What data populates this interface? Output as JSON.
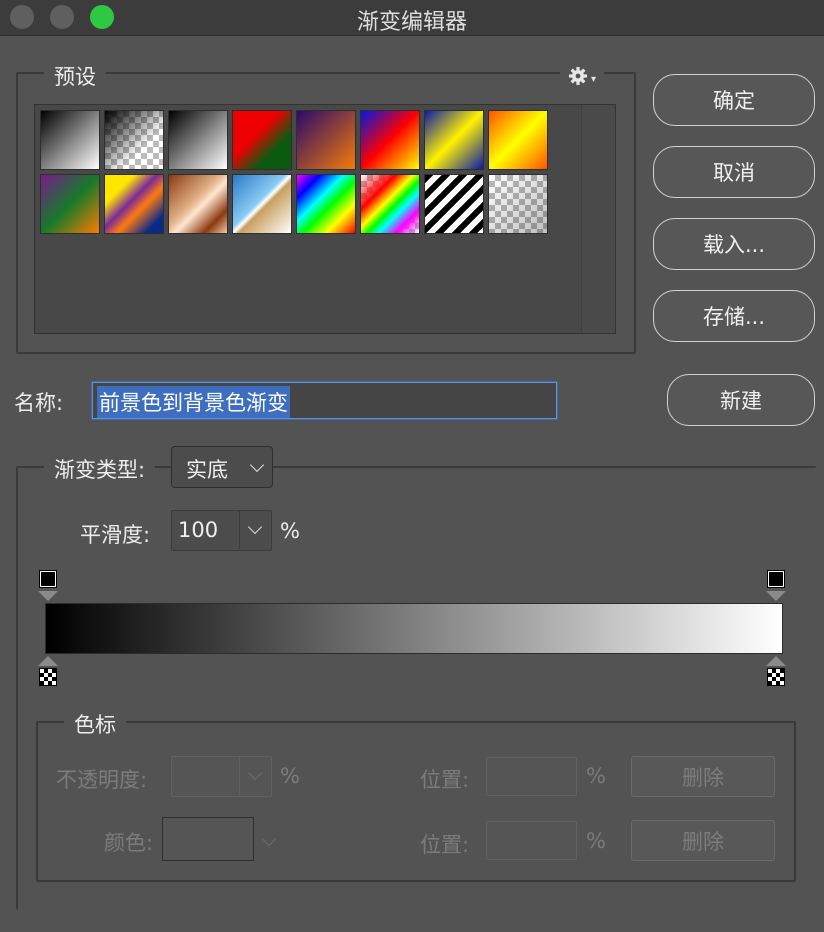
{
  "window": {
    "title": "渐变编辑器"
  },
  "presets": {
    "legend": "预设",
    "menu_icon": "gear-icon",
    "swatches": [
      {
        "name": "foreground-to-background",
        "css": "linear-gradient(135deg,#000 0%,#fff 100%)"
      },
      {
        "name": "foreground-to-transparent",
        "css": "linear-gradient(135deg,#000 0%,rgba(0,0,0,0) 65%)",
        "checker": true
      },
      {
        "name": "black-white",
        "css": "linear-gradient(135deg,#000 0%,#fff 100%)"
      },
      {
        "name": "red-green",
        "css": "linear-gradient(135deg,#e00 0%,#e00 40%,#0a5a10 70%,#0a5a10 100%)"
      },
      {
        "name": "violet-orange",
        "css": "linear-gradient(135deg,#2a0a6a 0%,#f47a08 100%)"
      },
      {
        "name": "blue-red-yellow",
        "css": "linear-gradient(135deg,#0018e0 0%,#ff0000 50%,#ffff00 100%)"
      },
      {
        "name": "blue-yellow-blue",
        "css": "linear-gradient(135deg,#0a1aa8 0%,#fff200 50%,#0a1aa8 100%)"
      },
      {
        "name": "orange-yellow-orange",
        "css": "linear-gradient(135deg,#ff5500 0%,#ffff00 50%,#ff5500 100%)"
      },
      {
        "name": "violet-green-orange",
        "css": "linear-gradient(135deg,#7a1a8c 0%,#167a2a 50%,#ff7a00 100%)"
      },
      {
        "name": "yellow-violet-orange-blue",
        "css": "linear-gradient(135deg,#ffe600 0%,#ffe600 25%,#7a2a9a 45%,#ff7a10 60%,#0a2a8a 85%)"
      },
      {
        "name": "copper",
        "css": "linear-gradient(135deg,#8a3a10 0%,#e4b48a 45%,#ffe6d0 55%,#8a3a10 80%,#f2c8a8 100%)"
      },
      {
        "name": "chrome",
        "css": "linear-gradient(135deg,#2a7ac8 0%,#8acbf4 45%,#ffffff 50%,#c8a060 55%,#fff 100%)"
      },
      {
        "name": "spectrum",
        "css": "linear-gradient(135deg,#ff00ff 0%,#0000ff 20%,#00ffff 40%,#00ff00 55%,#ffff00 75%,#ff0000 100%)"
      },
      {
        "name": "transparent-rainbow",
        "css": "linear-gradient(135deg,rgba(255,255,255,0) 0%,#ff0000 30%,#ffff00 45%,#00ff00 55%,#00ffff 65%,#ff00ff 80%,rgba(255,255,255,0) 100%)",
        "checker": true
      },
      {
        "name": "transparent-stripes",
        "css": "repeating-linear-gradient(135deg,#000 0px,#000 6px,#fff 6px,#fff 12px)"
      },
      {
        "name": "neutral-density",
        "css": "linear-gradient(135deg,rgba(0,0,0,0) 0%,rgba(0,0,0,0.25) 100%)",
        "checker": true
      }
    ]
  },
  "buttons": {
    "ok": "确定",
    "cancel": "取消",
    "load": "载入...",
    "save": "存储...",
    "new": "新建"
  },
  "name_field": {
    "label": "名称:",
    "value": "前景色到背景色渐变"
  },
  "gradient": {
    "type_label": "渐变类型:",
    "type_value": "实底",
    "smoothness_label": "平滑度:",
    "smoothness_value": "100",
    "smoothness_unit": "%",
    "bar_colors": [
      "#000000",
      "#ffffff"
    ]
  },
  "stops": {
    "legend": "色标",
    "opacity_label": "不透明度:",
    "opacity_value": "",
    "opacity_unit": "%",
    "color_label": "颜色:",
    "location_label": "位置:",
    "location_unit": "%",
    "delete_label": "删除"
  }
}
